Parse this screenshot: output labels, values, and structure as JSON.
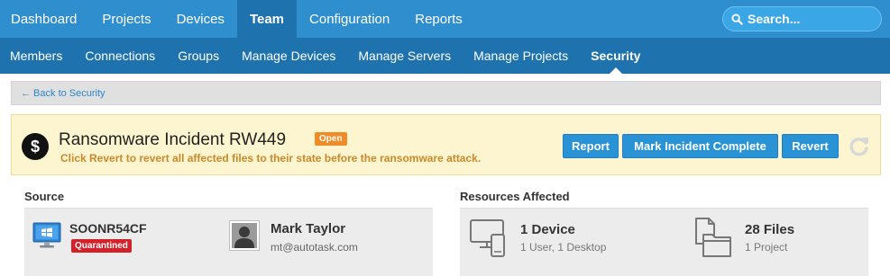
{
  "topnav": {
    "items": [
      {
        "label": "Dashboard"
      },
      {
        "label": "Projects"
      },
      {
        "label": "Devices"
      },
      {
        "label": "Team"
      },
      {
        "label": "Configuration"
      },
      {
        "label": "Reports"
      }
    ],
    "active": "Team",
    "search_placeholder": "Search..."
  },
  "subnav": {
    "items": [
      {
        "label": "Members"
      },
      {
        "label": "Connections"
      },
      {
        "label": "Groups"
      },
      {
        "label": "Manage Devices"
      },
      {
        "label": "Manage Servers"
      },
      {
        "label": "Manage Projects"
      },
      {
        "label": "Security"
      }
    ],
    "active": "Security"
  },
  "breadcrumb": {
    "back_label": "← Back to Security"
  },
  "incident": {
    "title": "Ransomware Incident RW449",
    "status": "Open",
    "message": "Click Revert to revert all affected files to their state before the ransomware attack.",
    "buttons": {
      "report": "Report",
      "complete": "Mark Incident Complete",
      "revert": "Revert"
    }
  },
  "source": {
    "heading": "Source",
    "device_name": "SOONR54CF",
    "device_status": "Quarantined",
    "user_name": "Mark Taylor",
    "user_email": "mt@autotask.com"
  },
  "resources": {
    "heading": "Resources Affected",
    "devices_title": "1 Device",
    "devices_detail": "1 User, 1 Desktop",
    "files_title": "28 Files",
    "files_detail": "1 Project"
  },
  "colors": {
    "topnav_bg": "#2f8fce",
    "subnav_bg": "#1e72ad",
    "banner_bg": "#fdf5cf",
    "button_blue": "#2a93d6",
    "open_badge": "#f08c28",
    "quarantined_badge": "#d42028"
  },
  "icons": {
    "search": "magnifier-icon",
    "incident": "dollar-icon",
    "refresh": "refresh-icon",
    "source_device": "windows-pc-icon",
    "user": "user-avatar-icon",
    "devices": "devices-icon",
    "files": "files-icon"
  }
}
